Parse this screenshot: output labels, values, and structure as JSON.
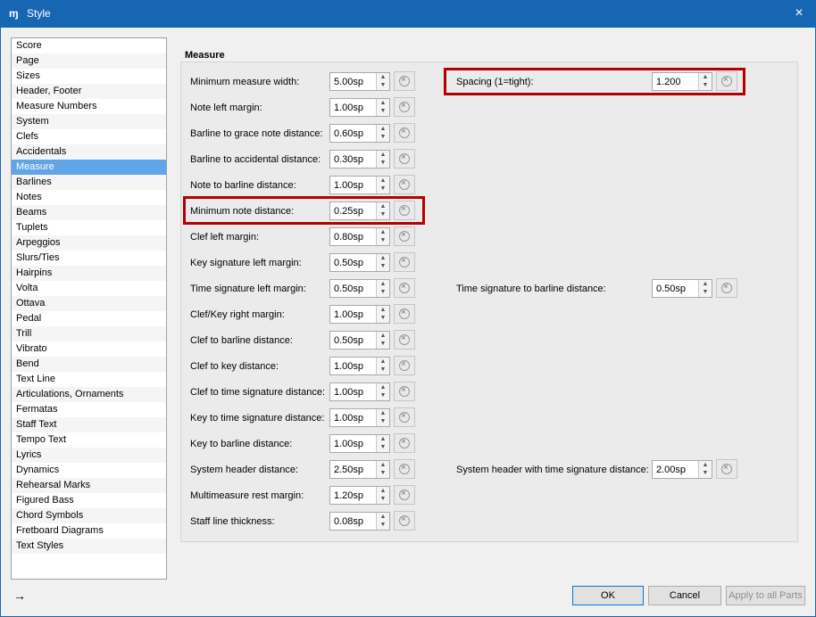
{
  "window": {
    "title": "Style",
    "icon": "musescore-icon",
    "close": "×"
  },
  "sidebar": {
    "items": [
      "Score",
      "Page",
      "Sizes",
      "Header, Footer",
      "Measure Numbers",
      "System",
      "Clefs",
      "Accidentals",
      "Measure",
      "Barlines",
      "Notes",
      "Beams",
      "Tuplets",
      "Arpeggios",
      "Slurs/Ties",
      "Hairpins",
      "Volta",
      "Ottava",
      "Pedal",
      "Trill",
      "Vibrato",
      "Bend",
      "Text Line",
      "Articulations, Ornaments",
      "Fermatas",
      "Staff Text",
      "Tempo Text",
      "Lyrics",
      "Dynamics",
      "Rehearsal Marks",
      "Figured Bass",
      "Chord Symbols",
      "Fretboard Diagrams",
      "Text Styles"
    ],
    "selected": "Measure"
  },
  "section": {
    "title": "Measure"
  },
  "rows": [
    {
      "label": "Minimum measure width:",
      "value": "5.00sp"
    },
    {
      "label": "Note left margin:",
      "value": "1.00sp"
    },
    {
      "label": "Barline to grace note distance:",
      "value": "0.60sp"
    },
    {
      "label": "Barline to accidental distance:",
      "value": "0.30sp"
    },
    {
      "label": "Note to barline distance:",
      "value": "1.00sp"
    },
    {
      "label": "Minimum note distance:",
      "value": "0.25sp"
    },
    {
      "label": "Clef left margin:",
      "value": "0.80sp"
    },
    {
      "label": "Key signature left margin:",
      "value": "0.50sp"
    },
    {
      "label": "Time signature left margin:",
      "value": "0.50sp"
    },
    {
      "label": "Clef/Key right margin:",
      "value": "1.00sp"
    },
    {
      "label": "Clef to barline distance:",
      "value": "0.50sp"
    },
    {
      "label": "Clef to key distance:",
      "value": "1.00sp"
    },
    {
      "label": "Clef to time signature distance:",
      "value": "1.00sp"
    },
    {
      "label": "Key to time signature distance:",
      "value": "1.00sp"
    },
    {
      "label": "Key to barline distance:",
      "value": "1.00sp"
    },
    {
      "label": "System header distance:",
      "value": "2.50sp"
    },
    {
      "label": "Multimeasure rest margin:",
      "value": "1.20sp"
    },
    {
      "label": "Staff line thickness:",
      "value": "0.08sp"
    }
  ],
  "right": {
    "spacing": {
      "label": "Spacing (1=tight):",
      "value": "1.200"
    },
    "time_sig_barline": {
      "label": "Time signature to barline distance:",
      "value": "0.50sp"
    },
    "header_time_sig": {
      "label": "System header with time signature distance:",
      "value": "2.00sp"
    }
  },
  "footer": {
    "ok": "OK",
    "cancel": "Cancel",
    "apply": "Apply to all Parts",
    "collapse_icon": "→"
  },
  "colors": {
    "titlebar": "#1766b4",
    "selected": "#5fa5e8",
    "highlight": "#b60000"
  }
}
